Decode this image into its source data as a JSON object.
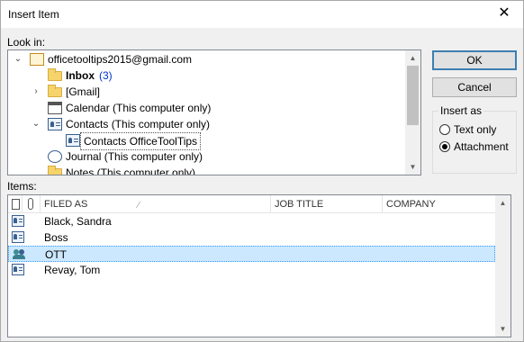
{
  "window": {
    "title": "Insert Item",
    "close_glyph": "✕"
  },
  "look_in": {
    "label": "Look in:",
    "tree": [
      {
        "label": "officetooltips2015@gmail.com",
        "icon": "account-icon"
      },
      {
        "label": "Inbox",
        "count": "(3)",
        "icon": "folder-icon"
      },
      {
        "label": "[Gmail]",
        "icon": "folder-icon"
      },
      {
        "label": "Calendar (This computer only)",
        "icon": "calendar-icon"
      },
      {
        "label": "Contacts (This computer only)",
        "icon": "contacts-icon"
      },
      {
        "label": "Contacts OfficeToolTips",
        "icon": "contacts-icon"
      },
      {
        "label": "Journal (This computer only)",
        "icon": "journal-icon"
      },
      {
        "label": "Notes (This computer only)",
        "icon": "folder-icon"
      }
    ]
  },
  "buttons": {
    "ok": "OK",
    "cancel": "Cancel"
  },
  "insert_as": {
    "title": "Insert as",
    "options": [
      "Text only",
      "Attachment"
    ],
    "selected": "Attachment"
  },
  "items": {
    "label": "Items:",
    "columns": [
      "FILED AS",
      "JOB TITLE",
      "COMPANY"
    ],
    "rows": [
      {
        "filed_as": "Black, Sandra",
        "icon": "contact-card-icon"
      },
      {
        "filed_as": "Boss",
        "icon": "contact-card-icon"
      },
      {
        "filed_as": "OTT",
        "icon": "contact-group-icon",
        "selected": true
      },
      {
        "filed_as": "Revay, Tom",
        "icon": "contact-card-icon"
      }
    ]
  }
}
